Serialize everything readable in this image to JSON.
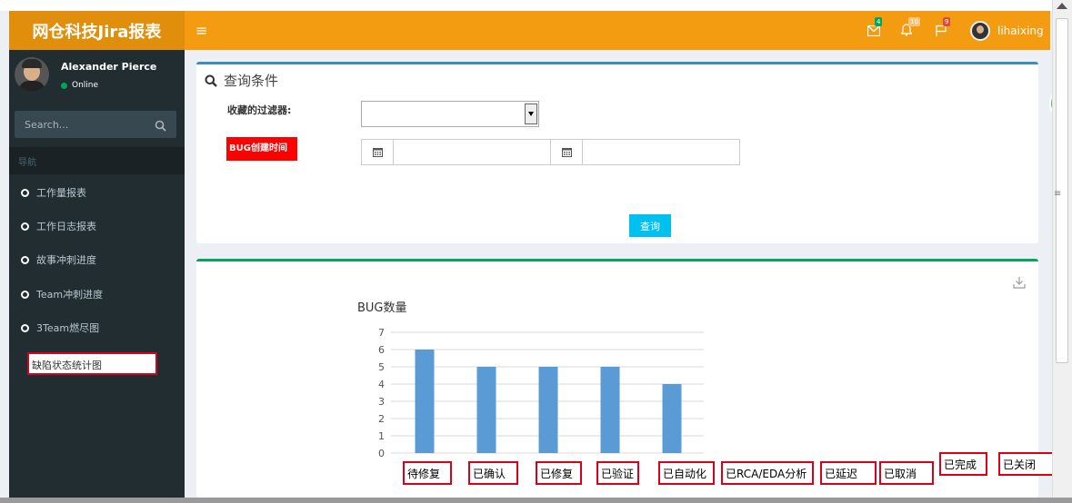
{
  "app": {
    "logo_text": "网仓科技Jira报表"
  },
  "navbar": {
    "messages_count": "4",
    "notifications_count": "10",
    "tasks_count": "9",
    "username": "lihaixing"
  },
  "sidebar": {
    "user_name": "Alexander Pierce",
    "user_status": "Online",
    "search_placeholder": "Search...",
    "nav_header": "导航",
    "items": [
      {
        "label": "工作量报表"
      },
      {
        "label": "工作日志报表"
      },
      {
        "label": "故事冲刺进度"
      },
      {
        "label": "Team冲刺进度"
      },
      {
        "label": "3Team燃尽图"
      }
    ],
    "active_item": "缺陷状态统计图"
  },
  "query_box": {
    "title": "查询条件",
    "filter_label": "收藏的过滤器:",
    "filter_value": "",
    "bug_created_label": "BUG创建时间",
    "date_from": "",
    "date_to": "",
    "query_button": "查询"
  },
  "chart_data": {
    "type": "bar",
    "title": "BUG数量",
    "categories": [
      "待修复",
      "已确认",
      "已修复",
      "已验证",
      "已自动化",
      "已RCA/EDA分析",
      "已延迟",
      "已取消",
      "已完成",
      "已关闭"
    ],
    "values": [
      6,
      5,
      5,
      5,
      4
    ],
    "ylim": [
      0,
      7
    ],
    "yticks": [
      0,
      1,
      2,
      3,
      4,
      5,
      6,
      7
    ],
    "xlabel": "",
    "ylabel": "",
    "grid": true,
    "color": "#5b9bd5"
  },
  "colors": {
    "navbar": "#f39c12",
    "logo_bg": "#e08e0b",
    "sidebar": "#222d32",
    "highlight_border": "#d9001b",
    "button": "#00c0ef"
  }
}
